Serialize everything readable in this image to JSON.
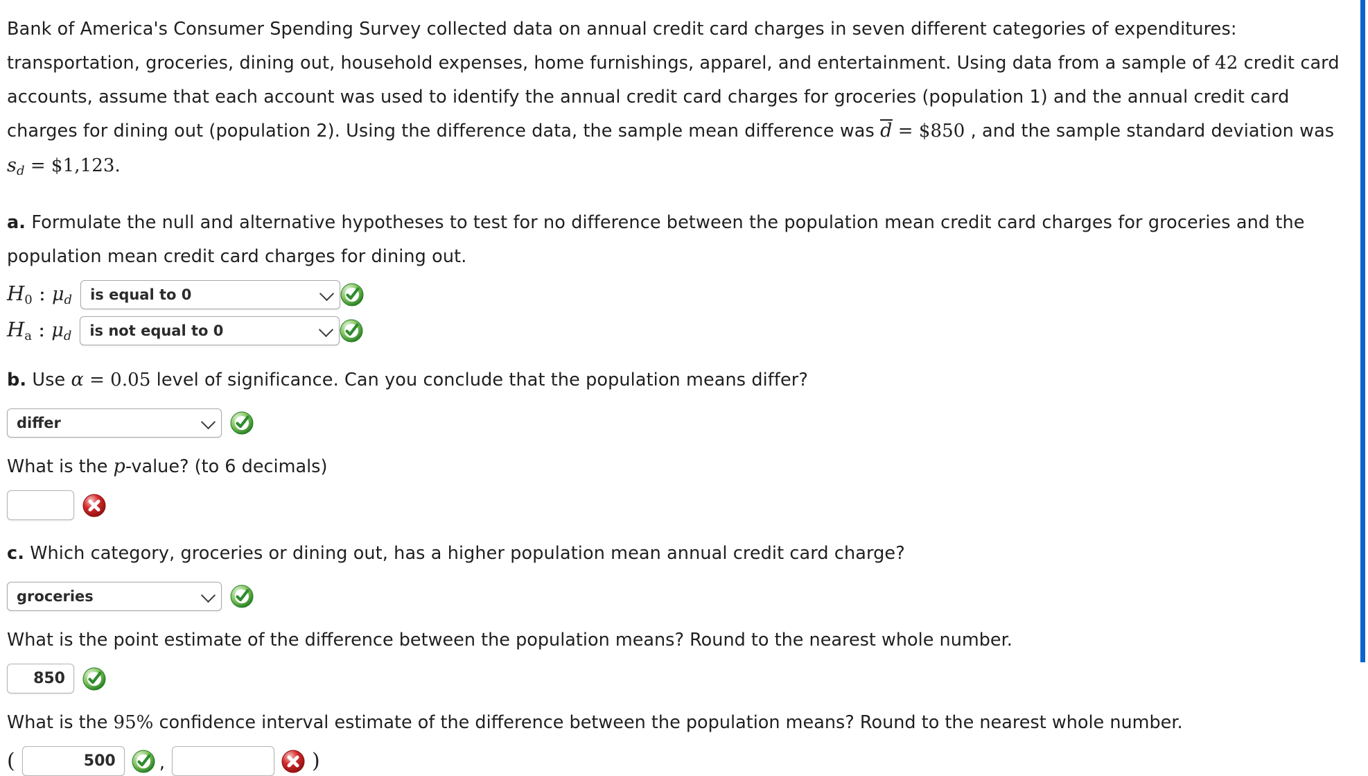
{
  "problem": {
    "intro_part1": "Bank of America's Consumer Spending Survey collected data on annual credit card charges in seven different categories of expenditures: transportation, groceries, dining out, household expenses, home furnishings, apparel, and entertainment. Using data from a sample of ",
    "sample_size": "42",
    "intro_part2": " credit card accounts, assume that each account was used to identify the annual credit card charges for groceries (population 1) and the annual credit card charges for dining out (population 2). Using the difference data, the sample mean difference was ",
    "dbar_symbol": "d",
    "equals": "=",
    "dbar_value": "$850",
    "intro_part3": " , and the sample standard deviation was ",
    "sd_symbol": "s",
    "sd_subscript": "d",
    "sd_value": "$1,123",
    "period": "."
  },
  "part_a": {
    "label": "a.",
    "text": " Formulate the null and alternative hypotheses to test for no difference between the population mean credit card charges for groceries and the population mean credit card charges for dining out.",
    "h0": {
      "symbol_H": "H",
      "symbol_sub": "0",
      "colon": ":",
      "mu": "μ",
      "mu_sub": "d",
      "selected": "is equal to 0",
      "status": "correct"
    },
    "ha": {
      "symbol_H": "H",
      "symbol_sub": "a",
      "colon": ":",
      "mu": "μ",
      "mu_sub": "d",
      "selected": "is not equal to 0",
      "status": "correct"
    }
  },
  "part_b": {
    "label": "b.",
    "text_before": " Use ",
    "alpha_symbol": "α",
    "alpha_equals": "=",
    "alpha_value": "0.05",
    "text_after": " level of significance. Can you conclude that the population means differ?",
    "conclusion_select": {
      "selected": "differ",
      "status": "correct"
    },
    "pvalue_question": "What is the p-value? (to 6 decimals)",
    "pvalue_question_prefix": "What is the ",
    "pvalue_italic": "p",
    "pvalue_question_suffix": "-value? (to 6 decimals)",
    "pvalue_input": {
      "value": "",
      "status": "incorrect"
    }
  },
  "part_c": {
    "label": "c.",
    "text": " Which category, groceries or dining out, has a higher population mean annual credit card charge?",
    "category_select": {
      "selected": "groceries",
      "status": "correct"
    },
    "point_estimate_question": "What is the point estimate of the difference between the population means? Round to the nearest whole number.",
    "point_estimate_input": {
      "value": "850",
      "status": "correct"
    },
    "ci_question_prefix": "What is the ",
    "ci_level": "95%",
    "ci_question_suffix": " confidence interval estimate of the difference between the population means? Round to the nearest whole number.",
    "ci_open_paren": "(",
    "ci_comma": ",",
    "ci_close_paren": ")",
    "ci_lower": {
      "value": "500",
      "status": "correct"
    },
    "ci_upper": {
      "value": "",
      "status": "incorrect"
    }
  },
  "colors": {
    "correct_green": "#2e8b2e",
    "incorrect_red": "#c21a1a",
    "rail_blue": "#0b63ce",
    "text": "#1f1f1f"
  }
}
